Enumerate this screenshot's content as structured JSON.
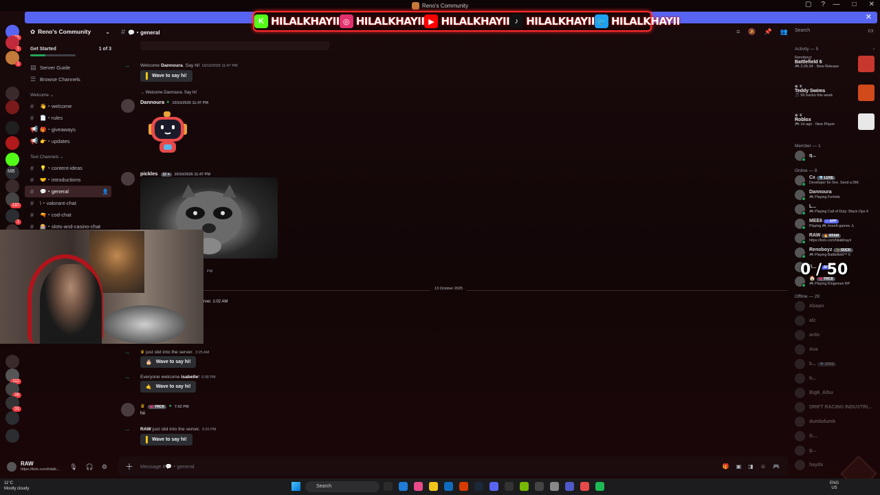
{
  "window": {
    "title": "Reno's Community"
  },
  "banner": {
    "socials": [
      {
        "icon": "kick-icon",
        "name": "HILALKHAYII",
        "color": "#53fc18"
      },
      {
        "icon": "instagram-icon",
        "name": "HILALKHAYII",
        "color": "#e1306c"
      },
      {
        "icon": "youtube-icon",
        "name": "HILALKHAYII",
        "color": "#ff0000"
      },
      {
        "icon": "tiktok-icon",
        "name": "HILALKHAYII",
        "color": "#111111"
      },
      {
        "icon": "twitter-icon",
        "name": "HILALKHAYII",
        "color": "#1da1f2"
      }
    ]
  },
  "rail": {
    "badges": [
      "155",
      "1",
      "1",
      "197",
      "1",
      "1",
      "112",
      "26",
      "31"
    ],
    "mb_label": "MB"
  },
  "sidebar": {
    "server_name": "Reno's Community",
    "get_started": {
      "label": "Get Started",
      "progress": "1 of 3",
      "fraction": 0.33
    },
    "top_items": [
      {
        "label": "Server Guide",
        "icon": "guide-icon"
      },
      {
        "label": "Browse Channels",
        "icon": "browse-icon"
      }
    ],
    "categories": [
      {
        "name": "Welcome ⌄",
        "channels": [
          {
            "label": "👋・welcome"
          },
          {
            "label": "📄・rules"
          },
          {
            "label": "🎁・giveaways"
          },
          {
            "label": "👉・updates"
          }
        ]
      },
      {
        "name": "Text Channels ⌄",
        "channels": [
          {
            "label": "💡・content-ideas"
          },
          {
            "label": "🤝・introductions"
          },
          {
            "label": "💬・general",
            "active": true
          },
          {
            "label": "\\・valorant-chat"
          },
          {
            "label": "🔫・cod-chat"
          },
          {
            "label": "🎰・slots-and-casino-chat"
          }
        ]
      }
    ]
  },
  "user_panel": {
    "name": "RAW",
    "status": "https://kick.com/hilalk..."
  },
  "header": {
    "channel": "💬・general",
    "search_placeholder": "Search"
  },
  "messages": {
    "m1": {
      "text_pre": "Welcome ",
      "name": "Dannoura",
      "text_post": ". Say hi!",
      "time": "10/10/2025 11:47 PM",
      "wave": "Wave to say hi!"
    },
    "m2": {
      "reply": "→ Welcome Dannoura. Say hi!",
      "author": "Dannoura",
      "time": "10/10/2025 11:47 PM"
    },
    "m3": {
      "author": "pickles",
      "time": "10/10/2025 11:47 PM"
    },
    "divider": "13 October 2025",
    "m4": {
      "text": "rver. 1:02 AM"
    },
    "m5": {
      "text": "just slid into the server.",
      "time": "3:25 AM",
      "wave": "Wave to say hi!"
    },
    "m6": {
      "text_pre": "Everyone welcome ",
      "name": "isabelle",
      "text_post": "!",
      "time": "6:58 PM",
      "wave": "Wave to say hi!"
    },
    "m7": {
      "tag": "💗 FRCK",
      "time": "7:02 PM",
      "text": "hii"
    },
    "m8": {
      "name": "RAW",
      "text": " just slid into the server.",
      "time": "9:20 PM",
      "wave": "Wave to say hi!"
    },
    "partial_time": "PM"
  },
  "composer": {
    "placeholder": "Message #💬・general"
  },
  "right_panel": {
    "activity_header": "Activity — 5",
    "activities": [
      {
        "user": "Renoboyz",
        "game": "Battlefield 6",
        "detail": "🎮 2:25:34 · New Release",
        "art": "#c8372d"
      },
      {
        "user": "",
        "game": "Teddy Swims",
        "detail": "🎵 56 tracks this week",
        "art": "#d04a1c"
      },
      {
        "user": "",
        "game": "Roblox",
        "detail": "🎮 1d ago · New Player",
        "art": "#e8e8e8"
      }
    ],
    "member_header": "Member — 1",
    "member_role": [
      {
        "name": "q...",
        "status": ""
      }
    ],
    "online_header": "Online — 8",
    "online": [
      {
        "name": "Cx",
        "tag": "💎 LUXE",
        "status": "Developer for hire. Send a DM."
      },
      {
        "name": "Dannoura",
        "tag": "",
        "status": "🎮 Playing Fortnite"
      },
      {
        "name": "L...",
        "tag": "",
        "status": "🎮 Playing Call of Duty: Black Ops 4"
      },
      {
        "name": "MEE6",
        "tag": "✓ APP",
        "status": "Playing 🎮 /mee6-games ⚓"
      },
      {
        "name": "RAW",
        "tag": "🔥 RFAM",
        "status": "https://kick.com/hilalkhayii"
      },
      {
        "name": "Renoboyz",
        "tag": "🦆 DUCK",
        "status": "🎮 Playing Battlefield™ 6"
      },
      {
        "name": "S...",
        "tag": "✓ APP",
        "status": ""
      },
      {
        "name": "🏠",
        "tag": "💗 FRCK",
        "status": "🎮 Playing Kingsmen RP"
      }
    ],
    "counter": "0 / 50",
    "offline_header": "Offline — 29",
    "offline": [
      {
        "name": "Abaan"
      },
      {
        "name": "alz"
      },
      {
        "name": "ardo"
      },
      {
        "name": "Ava"
      },
      {
        "name": "b...",
        "tag": "💎 JOKE"
      },
      {
        "name": "b..."
      },
      {
        "name": "Big6_Albu"
      },
      {
        "name": "DRIFT RACING INDUSTRI..."
      },
      {
        "name": "dumbdumb"
      },
      {
        "name": "G..."
      },
      {
        "name": "g..."
      },
      {
        "name": "haydx"
      }
    ]
  },
  "taskbar": {
    "weather_temp": "11°C",
    "weather_desc": "Mostly cloudy",
    "search": "Search",
    "lang": "ENG",
    "region": "US"
  }
}
